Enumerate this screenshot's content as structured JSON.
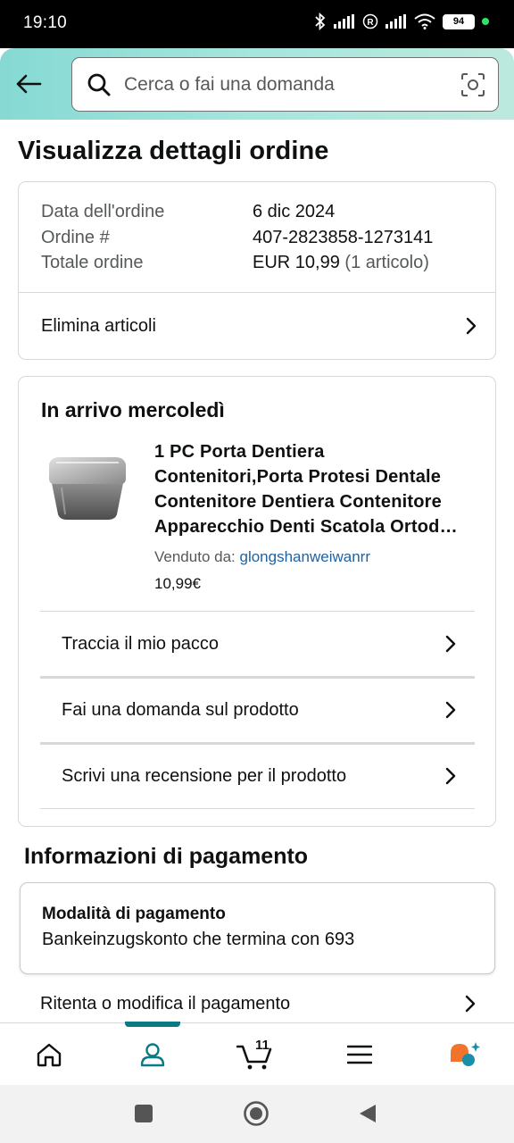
{
  "status_bar": {
    "time": "19:10",
    "battery": "94"
  },
  "search": {
    "placeholder": "Cerca o fai una domanda"
  },
  "page": {
    "title": "Visualizza dettagli ordine"
  },
  "order_summary": {
    "date_label": "Data dell'ordine",
    "date_value": "6 dic 2024",
    "number_label": "Ordine #",
    "number_value": "407-2823858-1273141",
    "total_label": "Totale ordine",
    "total_value": "EUR 10,99",
    "total_items": "(1 articolo)",
    "delete_items": "Elimina articoli"
  },
  "shipment": {
    "heading": "In arrivo mercoledì",
    "product_title": "1 PC Porta Dentiera Contenitori,Porta Protesi Dentale Contenitore Dentiera Contenitore Apparecchio Denti Scatola Ortod…",
    "seller_label": "Venduto da:",
    "seller_name": "glongshanweiwanrr",
    "price": "10,99€",
    "actions": [
      "Traccia il mio pacco",
      "Fai una domanda sul prodotto",
      "Scrivi una recensione per il prodotto"
    ]
  },
  "payment": {
    "heading": "Informazioni di pagamento",
    "method_label": "Modalità di pagamento",
    "method_value": "Bankeinzugskonto che termina con 693",
    "retry": "Ritenta o modifica il pagamento"
  },
  "bottom_nav": {
    "cart_count": "11",
    "active": "account",
    "accent_color": "#0b7b83"
  },
  "colors": {
    "header_gradient_start": "#86d9d4",
    "link": "#2162a1",
    "ai_orange": "#f2732a",
    "ai_teal": "#1b8fa8"
  }
}
